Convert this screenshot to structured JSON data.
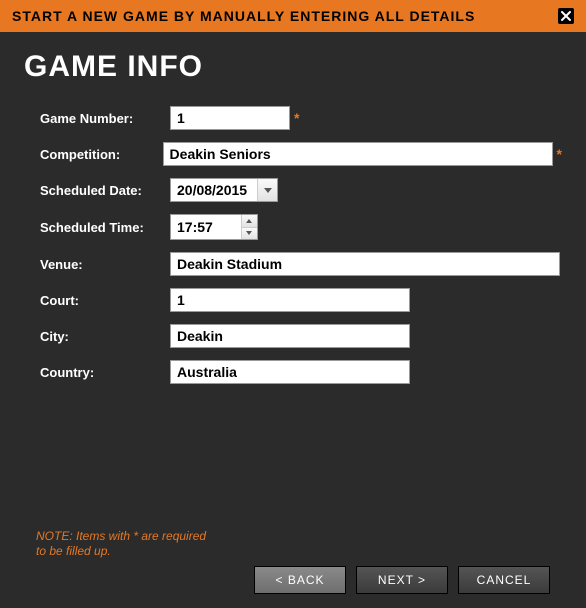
{
  "header": {
    "title": "START A NEW GAME BY MANUALLY ENTERING ALL DETAILS"
  },
  "page_title": "GAME INFO",
  "form": {
    "game_number": {
      "label": "Game Number:",
      "value": "1",
      "required": true
    },
    "competition": {
      "label": "Competition:",
      "value": "Deakin Seniors",
      "required": true
    },
    "scheduled_date": {
      "label": "Scheduled Date:",
      "value": "20/08/2015"
    },
    "scheduled_time": {
      "label": "Scheduled Time:",
      "value": "17:57"
    },
    "venue": {
      "label": "Venue:",
      "value": "Deakin Stadium"
    },
    "court": {
      "label": "Court:",
      "value": "1"
    },
    "city": {
      "label": "City:",
      "value": "Deakin"
    },
    "country": {
      "label": "Country:",
      "value": "Australia"
    }
  },
  "note": "NOTE: Items with * are required to be filled up.",
  "buttons": {
    "back": "< BACK",
    "next": "NEXT >",
    "cancel": "CANCEL"
  },
  "required_marker": "*"
}
